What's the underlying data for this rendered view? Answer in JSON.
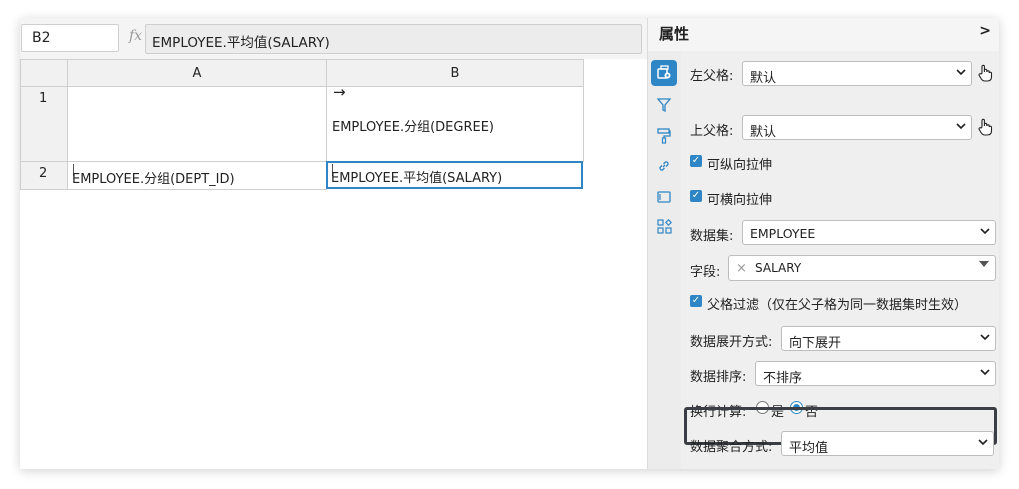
{
  "formula_bar": {
    "cell_ref": "B2",
    "fx_symbol": "fx",
    "formula": "EMPLOYEE.平均值(SALARY)"
  },
  "grid": {
    "columns": [
      "A",
      "B"
    ],
    "rows": [
      "1",
      "2"
    ],
    "cells": {
      "B1_arrow": "→",
      "B1": "EMPLOYEE.分组(DEGREE)",
      "A2": "EMPLOYEE.分组(DEPT_ID)",
      "B2": "EMPLOYEE.平均值(SALARY)"
    }
  },
  "panel": {
    "title": "属性",
    "collapse": ">",
    "left_parent_label": "左父格:",
    "left_parent_value": "默认",
    "top_parent_label": "上父格:",
    "top_parent_value": "默认",
    "vertical_stretch": "可纵向拉伸",
    "horizontal_stretch": "可横向拉伸",
    "dataset_label": "数据集:",
    "dataset_value": "EMPLOYEE",
    "field_label": "字段:",
    "field_value": "SALARY",
    "field_remove": "×",
    "parent_filter": "父格过滤（仅在父子格为同一数据集时生效）",
    "expand_label": "数据展开方式:",
    "expand_value": "向下展开",
    "sort_label": "数据排序:",
    "sort_value": "不排序",
    "wrap_calc_label": "换行计算:",
    "wrap_yes": "是",
    "wrap_no": "否",
    "agg_label": "数据聚合方式:",
    "agg_value": "平均值",
    "check_mark": "✓",
    "chevron": "⌄"
  },
  "colors": {
    "accent": "#2e86c6",
    "highlight_border": "#3b3f45"
  }
}
